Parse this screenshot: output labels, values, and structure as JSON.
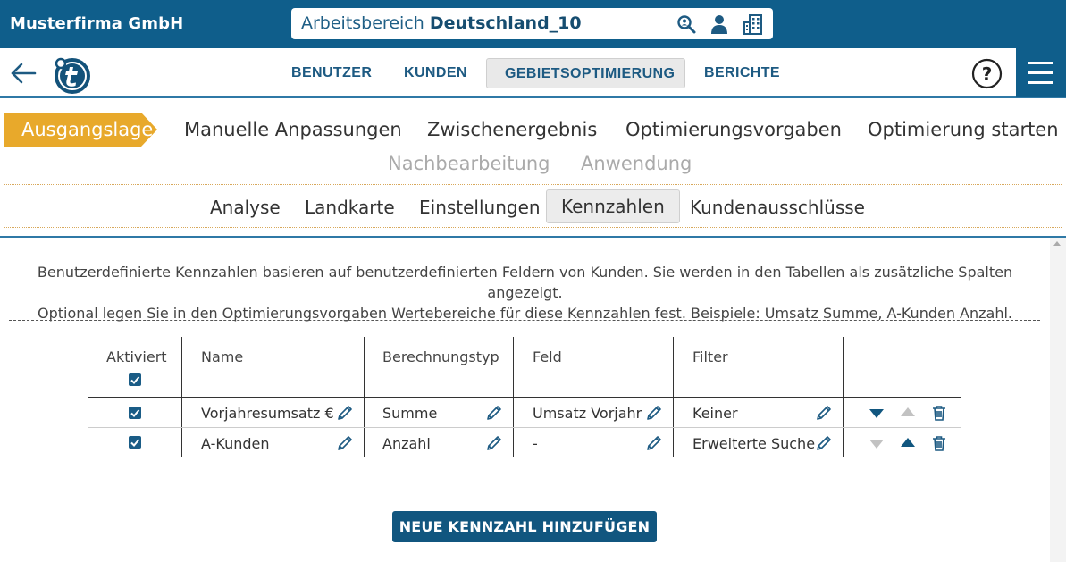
{
  "header": {
    "company": "Musterfirma GmbH",
    "workspace_prefix": "Arbeitsbereich",
    "workspace_name": "Deutschland_10",
    "bg_color": "#0f5e8b"
  },
  "nav": {
    "items": [
      {
        "label": "BENUTZER",
        "active": false
      },
      {
        "label": "KUNDEN",
        "active": false
      },
      {
        "label": "GEBIETSOPTIMIERUNG",
        "active": true
      },
      {
        "label": "BERICHTE",
        "active": false
      }
    ],
    "help": "?"
  },
  "steps": {
    "items": [
      {
        "label": "Ausgangslage",
        "state": "active"
      },
      {
        "label": "Manuelle Anpassungen",
        "state": "normal"
      },
      {
        "label": "Zwischenergebnis",
        "state": "normal"
      },
      {
        "label": "Optimierungsvorgaben",
        "state": "normal"
      },
      {
        "label": "Optimierung starten",
        "state": "normal"
      },
      {
        "label": "Nachbearbeitung",
        "state": "disabled"
      },
      {
        "label": "Anwendung",
        "state": "disabled"
      }
    ],
    "active_color": "#e8a92b"
  },
  "subtabs": [
    {
      "label": "Analyse",
      "active": false
    },
    {
      "label": "Landkarte",
      "active": false
    },
    {
      "label": "Einstellungen",
      "active": false
    },
    {
      "label": "Kennzahlen",
      "active": true
    },
    {
      "label": "Kundenausschlüsse",
      "active": false
    }
  ],
  "description": {
    "line1": "Benutzerdefinierte Kennzahlen basieren auf benutzerdefinierten Feldern von Kunden. Sie werden in den Tabellen als zusätzliche Spalten angezeigt.",
    "line2": "Optional legen Sie in den Optimierungsvorgaben Wertebereiche für diese Kennzahlen fest. Beispiele: Umsatz Summe, A-Kunden Anzahl."
  },
  "table": {
    "columns": [
      "Aktiviert",
      "Name",
      "Berechnungstyp",
      "Feld",
      "Filter"
    ],
    "header_checked": true,
    "rows": [
      {
        "active": true,
        "name": "Vorjahresumsatz €",
        "type": "Summe",
        "field": "Umsatz Vorjahr",
        "filter": "Keiner",
        "can_move_down": true,
        "can_move_up": false
      },
      {
        "active": true,
        "name": "A-Kunden",
        "type": "Anzahl",
        "field": "-",
        "filter": "Erweiterte Suche",
        "can_move_down": false,
        "can_move_up": true
      }
    ]
  },
  "add_button": "NEUE KENNZAHL HINZUFÜGEN"
}
